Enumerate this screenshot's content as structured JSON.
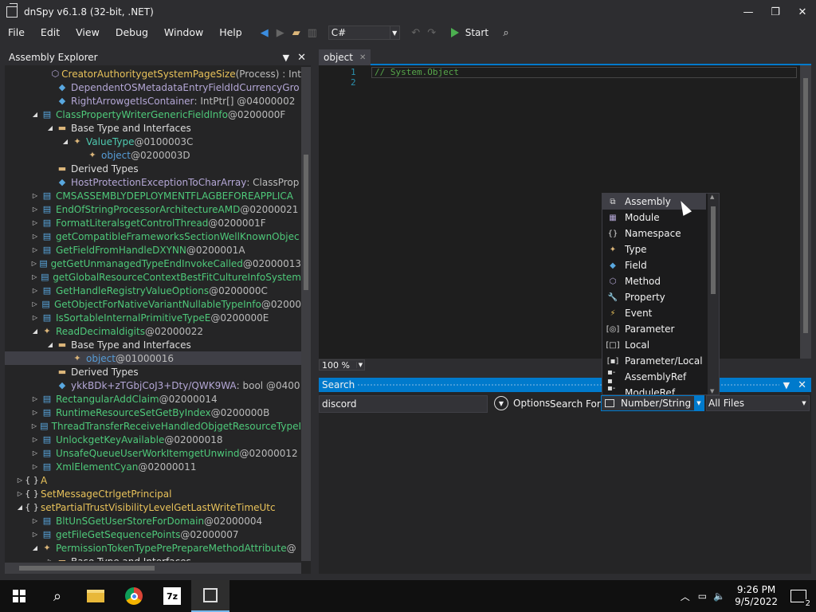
{
  "window": {
    "title": "dnSpy v6.1.8 (32-bit, .NET)"
  },
  "menu": [
    "File",
    "Edit",
    "View",
    "Debug",
    "Window",
    "Help"
  ],
  "toolbar": {
    "language": "C#",
    "start_label": "Start"
  },
  "explorer": {
    "title": "Assembly Explorer",
    "rows": [
      {
        "indent": 4,
        "exp": "",
        "icon": "method-icon",
        "glyph": "⬡",
        "color": "#b4a7d6",
        "text": "CreatorAuthoritygetSystemPageSize",
        "tokens": "",
        "textColor": "#e8c25a",
        "extra": "(Process) : Int"
      },
      {
        "indent": 4,
        "exp": "",
        "icon": "field-icon",
        "glyph": "◆",
        "color": "#59a8e0",
        "text": "DependentOSMetadataEntryFieldIdCurrencyGro",
        "tokens": "",
        "textColor": "#b4a7d6"
      },
      {
        "indent": 4,
        "exp": "",
        "icon": "field-icon",
        "glyph": "◆",
        "color": "#59a8e0",
        "text": "RightArrowgetIsContainer",
        "tokens": " : IntPtr[] @04000002",
        "textColor": "#b4a7d6"
      },
      {
        "indent": 3,
        "exp": "◢",
        "icon": "class-icon",
        "glyph": "▤",
        "color": "#59a8e0",
        "text": "ClassPropertyWriterGenericFieldInfo",
        "tokens": " @0200000F",
        "textColor": "#4ec97a"
      },
      {
        "indent": 4,
        "exp": "◢",
        "icon": "folder-icon",
        "glyph": "▬",
        "color": "#dcb67a",
        "text": "Base Type and Interfaces",
        "tokens": "",
        "textColor": "#dcdcdc"
      },
      {
        "indent": 5,
        "exp": "◢",
        "icon": "type-icon",
        "glyph": "✦",
        "color": "#dcb67a",
        "text": "ValueType",
        "tokens": " @0100003C",
        "textColor": "#4ec9b0"
      },
      {
        "indent": 6,
        "exp": "",
        "icon": "type-icon",
        "glyph": "✦",
        "color": "#dcb67a",
        "text": "object",
        "tokens": " @0200003D",
        "textColor": "#569cd6"
      },
      {
        "indent": 4,
        "exp": "",
        "icon": "folder-icon",
        "glyph": "▬",
        "color": "#dcb67a",
        "text": "Derived Types",
        "tokens": "",
        "textColor": "#dcdcdc"
      },
      {
        "indent": 4,
        "exp": "",
        "icon": "field-icon",
        "glyph": "◆",
        "color": "#59a8e0",
        "text": "HostProtectionExceptionToCharArray",
        "tokens": " : ClassProp",
        "textColor": "#b4a7d6"
      },
      {
        "indent": 3,
        "exp": "▷",
        "icon": "class-icon",
        "glyph": "▤",
        "color": "#59a8e0",
        "text": "CMSASSEMBLYDEPLOYMENTFLAGBEFOREAPPLICA",
        "tokens": "",
        "textColor": "#4ec97a"
      },
      {
        "indent": 3,
        "exp": "▷",
        "icon": "class-icon",
        "glyph": "▤",
        "color": "#59a8e0",
        "text": "EndOfStringProcessorArchitectureAMD",
        "tokens": " @02000021",
        "textColor": "#4ec97a"
      },
      {
        "indent": 3,
        "exp": "▷",
        "icon": "class-icon",
        "glyph": "▤",
        "color": "#59a8e0",
        "text": "FormatLiteralsgetControlThread",
        "tokens": " @0200001F",
        "textColor": "#4ec97a"
      },
      {
        "indent": 3,
        "exp": "▷",
        "icon": "class-icon",
        "glyph": "▤",
        "color": "#59a8e0",
        "text": "getCompatibleFrameworksSectionWellKnownObjec",
        "tokens": "",
        "textColor": "#4ec97a"
      },
      {
        "indent": 3,
        "exp": "▷",
        "icon": "class-icon",
        "glyph": "▤",
        "color": "#59a8e0",
        "text": "GetFieldFromHandleDXYNN",
        "tokens": " @0200001A",
        "textColor": "#4ec97a"
      },
      {
        "indent": 3,
        "exp": "▷",
        "icon": "class-icon",
        "glyph": "▤",
        "color": "#59a8e0",
        "text": "getGetUnmanagedTypeEndInvokeCalled",
        "tokens": " @02000013",
        "textColor": "#4ec97a"
      },
      {
        "indent": 3,
        "exp": "▷",
        "icon": "class-icon",
        "glyph": "▤",
        "color": "#59a8e0",
        "text": "getGlobalResourceContextBestFitCultureInfoSystem",
        "tokens": "",
        "textColor": "#4ec97a"
      },
      {
        "indent": 3,
        "exp": "▷",
        "icon": "class-icon",
        "glyph": "▤",
        "color": "#59a8e0",
        "text": "GetHandleRegistryValueOptions",
        "tokens": " @0200000C",
        "textColor": "#4ec97a"
      },
      {
        "indent": 3,
        "exp": "▷",
        "icon": "class-icon",
        "glyph": "▤",
        "color": "#59a8e0",
        "text": "GetObjectForNativeVariantNullableTypeInfo",
        "tokens": " @02000",
        "textColor": "#4ec97a"
      },
      {
        "indent": 3,
        "exp": "▷",
        "icon": "class-icon",
        "glyph": "▤",
        "color": "#59a8e0",
        "text": "IsSortableInternalPrimitiveTypeE",
        "tokens": " @0200000E",
        "textColor": "#4ec97a"
      },
      {
        "indent": 3,
        "exp": "◢",
        "icon": "type-icon",
        "glyph": "✦",
        "color": "#dcb67a",
        "text": "ReadDecimaldigits",
        "tokens": " @02000022",
        "textColor": "#4ec97a"
      },
      {
        "indent": 4,
        "exp": "◢",
        "icon": "folder-icon",
        "glyph": "▬",
        "color": "#dcb67a",
        "text": "Base Type and Interfaces",
        "tokens": "",
        "textColor": "#dcdcdc"
      },
      {
        "indent": 5,
        "exp": "",
        "icon": "type-icon",
        "glyph": "✦",
        "color": "#dcb67a",
        "text": "object",
        "tokens": " @01000016",
        "textColor": "#569cd6",
        "selected": true
      },
      {
        "indent": 4,
        "exp": "",
        "icon": "folder-icon",
        "glyph": "▬",
        "color": "#dcb67a",
        "text": "Derived Types",
        "tokens": "",
        "textColor": "#dcdcdc"
      },
      {
        "indent": 4,
        "exp": "",
        "icon": "field-icon",
        "glyph": "◆",
        "color": "#59a8e0",
        "text": "ykkBDk+zTGbjCoJ3+Dty/QWK9WA",
        "tokens": " : bool @0400",
        "textColor": "#b4a7d6"
      },
      {
        "indent": 3,
        "exp": "▷",
        "icon": "class-icon",
        "glyph": "▤",
        "color": "#59a8e0",
        "text": "RectangularAddClaim",
        "tokens": " @02000014",
        "textColor": "#4ec97a"
      },
      {
        "indent": 3,
        "exp": "▷",
        "icon": "class-icon",
        "glyph": "▤",
        "color": "#59a8e0",
        "text": "RuntimeResourceSetGetByIndex",
        "tokens": " @0200000B",
        "textColor": "#4ec97a"
      },
      {
        "indent": 3,
        "exp": "▷",
        "icon": "class-icon",
        "glyph": "▤",
        "color": "#59a8e0",
        "text": "ThreadTransferReceiveHandledObjgetResourceTypeI",
        "tokens": "",
        "textColor": "#4ec97a"
      },
      {
        "indent": 3,
        "exp": "▷",
        "icon": "class-icon",
        "glyph": "▤",
        "color": "#59a8e0",
        "text": "UnlockgetKeyAvailable",
        "tokens": " @02000018",
        "textColor": "#4ec97a"
      },
      {
        "indent": 3,
        "exp": "▷",
        "icon": "class-icon",
        "glyph": "▤",
        "color": "#59a8e0",
        "text": "UnsafeQueueUserWorkItemgetUnwind",
        "tokens": " @02000012",
        "textColor": "#4ec97a"
      },
      {
        "indent": 3,
        "exp": "▷",
        "icon": "class-icon",
        "glyph": "▤",
        "color": "#59a8e0",
        "text": "XmlElementCyan",
        "tokens": " @02000011",
        "textColor": "#4ec97a"
      },
      {
        "indent": 2,
        "exp": "▷",
        "icon": "namespace-icon",
        "glyph": "{ }",
        "color": "#dcdcdc",
        "text": "A",
        "tokens": "",
        "textColor": "#e8c25a"
      },
      {
        "indent": 2,
        "exp": "▷",
        "icon": "namespace-icon",
        "glyph": "{ }",
        "color": "#dcdcdc",
        "text": "SetMessageCtrlgetPrincipal",
        "tokens": "",
        "textColor": "#e8c25a"
      },
      {
        "indent": 2,
        "exp": "◢",
        "icon": "namespace-icon",
        "glyph": "{ }",
        "color": "#dcdcdc",
        "text": "setPartialTrustVisibilityLevelGetLastWriteTimeUtc",
        "tokens": "",
        "textColor": "#e8c25a"
      },
      {
        "indent": 3,
        "exp": "▷",
        "icon": "class-icon",
        "glyph": "▤",
        "color": "#59a8e0",
        "text": "BltUnSGetUserStoreForDomain",
        "tokens": " @02000004",
        "textColor": "#4ec97a"
      },
      {
        "indent": 3,
        "exp": "▷",
        "icon": "class-icon",
        "glyph": "▤",
        "color": "#59a8e0",
        "text": "getFileGetSequencePoints",
        "tokens": " @02000007",
        "textColor": "#4ec97a"
      },
      {
        "indent": 3,
        "exp": "◢",
        "icon": "type-icon",
        "glyph": "✦",
        "color": "#dcb67a",
        "text": "PermissionTokenTypePrePrepareMethodAttribute",
        "tokens": " @",
        "textColor": "#4ec97a"
      },
      {
        "indent": 4,
        "exp": "▷",
        "icon": "folder-icon",
        "glyph": "▬",
        "color": "#dcb67a",
        "text": "Base Type and Interfaces",
        "tokens": "",
        "textColor": "#dcdcdc"
      }
    ]
  },
  "editor": {
    "tab_label": "object",
    "line_numbers": "1\n2",
    "code_line_1": "// System.Object",
    "zoom": "100 %"
  },
  "search": {
    "title": "Search",
    "query": "discord",
    "options_label": "Options",
    "search_for_label": "Search For:",
    "search_for_value": "Number/String",
    "scope_value": "All Files",
    "dropdown_items": [
      {
        "label": "Assembly",
        "icon": "assembly-icon",
        "glyph": "⧉",
        "color": "#dcdcdc"
      },
      {
        "label": "Module",
        "icon": "module-icon",
        "glyph": "▦",
        "color": "#b4a7d6"
      },
      {
        "label": "Namespace",
        "icon": "namespace-icon",
        "glyph": "{}",
        "color": "#dcdcdc"
      },
      {
        "label": "Type",
        "icon": "type-icon",
        "glyph": "✦",
        "color": "#dcb67a"
      },
      {
        "label": "Field",
        "icon": "field-icon",
        "glyph": "◆",
        "color": "#59a8e0"
      },
      {
        "label": "Method",
        "icon": "method-icon",
        "glyph": "⬡",
        "color": "#b4a7d6"
      },
      {
        "label": "Property",
        "icon": "property-icon",
        "glyph": "🔧",
        "color": "#dcdcdc"
      },
      {
        "label": "Event",
        "icon": "event-icon",
        "glyph": "⚡",
        "color": "#e8c25a"
      },
      {
        "label": "Parameter",
        "icon": "parameter-icon",
        "glyph": "[◎]",
        "color": "#dcdcdc"
      },
      {
        "label": "Local",
        "icon": "local-icon",
        "glyph": "[□]",
        "color": "#dcdcdc"
      },
      {
        "label": "Parameter/Local",
        "icon": "parameter-local-icon",
        "glyph": "[▪]",
        "color": "#dcdcdc"
      },
      {
        "label": "AssemblyRef",
        "icon": "assemblyref-icon",
        "glyph": "▪-▪",
        "color": "#dcdcdc"
      },
      {
        "label": "ModuleRef",
        "icon": "moduleref-icon",
        "glyph": "▪-▪",
        "color": "#dcdcdc"
      }
    ]
  },
  "taskbar": {
    "time": "9:26 PM",
    "date": "9/5/2022",
    "notification_count": "2",
    "zip_label": "7z"
  }
}
